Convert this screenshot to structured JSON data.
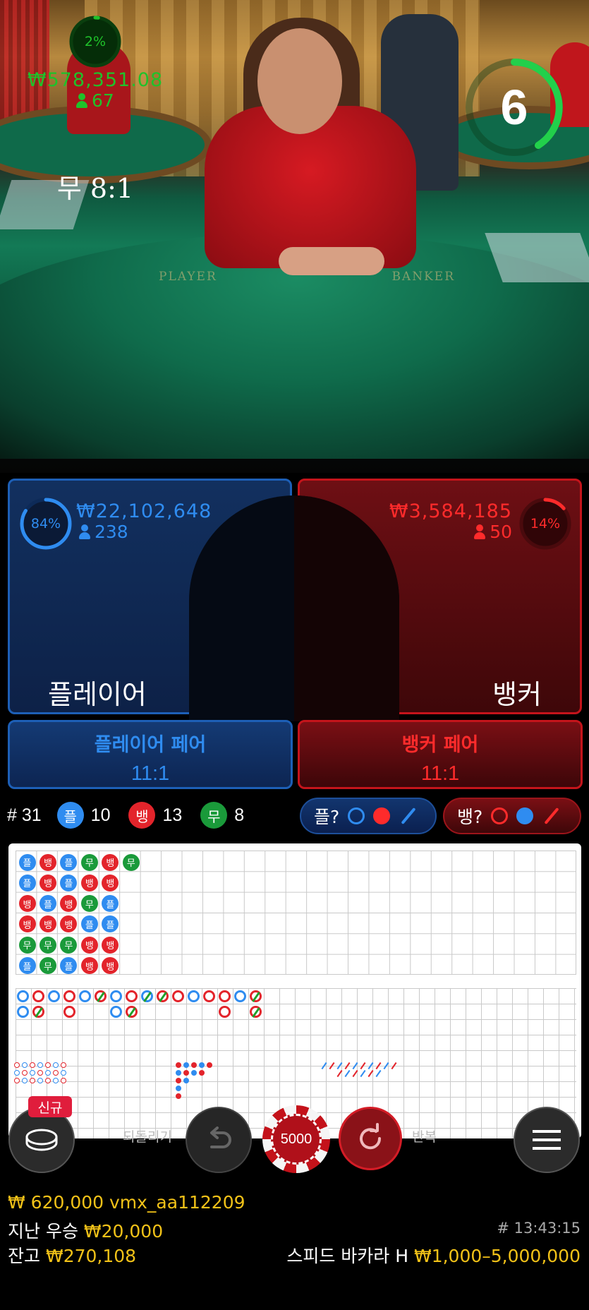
{
  "colors": {
    "player": "#2f8cf0",
    "banker": "#ff2b2b",
    "tie": "#1fc22a",
    "accent_yellow": "#f2c218"
  },
  "video": {
    "felt_left": "PLAYER",
    "felt_right": "BANKER",
    "countdown": "6"
  },
  "bets": {
    "player": {
      "percent": "84%",
      "percent_value": 0.84,
      "amount": "₩22,102,648",
      "players": "238",
      "label": "플레이어"
    },
    "tie": {
      "percent": "2%",
      "percent_value": 0.02,
      "amount": "₩578,351.08",
      "players": "67",
      "label": "무 8:1"
    },
    "banker": {
      "percent": "14%",
      "percent_value": 0.14,
      "amount": "₩3,584,185",
      "players": "50",
      "label": "뱅커"
    }
  },
  "pairs": {
    "player": {
      "title": "플레이어 페어",
      "odds": "11:1"
    },
    "banker": {
      "title": "뱅커 페어",
      "odds": "11:1"
    }
  },
  "stats": {
    "round": "# 31",
    "player": {
      "badge": "플",
      "count": "10"
    },
    "banker": {
      "badge": "뱅",
      "count": "13"
    },
    "tie": {
      "badge": "무",
      "count": "8"
    }
  },
  "ask": {
    "player_label": "플?",
    "banker_label": "뱅?"
  },
  "bead_road": [
    [
      "플",
      "플",
      "뱅",
      "뱅",
      "무",
      "플"
    ],
    [
      "뱅",
      "뱅",
      "플",
      "뱅",
      "무",
      "무"
    ],
    [
      "플",
      "플",
      "뱅",
      "뱅",
      "무",
      "플"
    ],
    [
      "무",
      "뱅",
      "무",
      "플",
      "뱅",
      "뱅"
    ],
    [
      "뱅",
      "뱅",
      "플",
      "플",
      "뱅",
      "뱅"
    ],
    [
      "무"
    ]
  ],
  "controls": {
    "new_badge": "신규",
    "undo_label": "되돌리기",
    "repeat_label": "반복",
    "chip_value": "5000"
  },
  "footer": {
    "last_bet": "₩ 620,000 vmx_aa112209",
    "last_win_label": "지난 우승",
    "last_win_value": "₩20,000",
    "balance_label": "잔고",
    "balance_value": "₩270,108",
    "game_id": "# 13:43:15",
    "table_name": "스피드 바카라 H",
    "limits": "₩1,000–5,000,000"
  }
}
